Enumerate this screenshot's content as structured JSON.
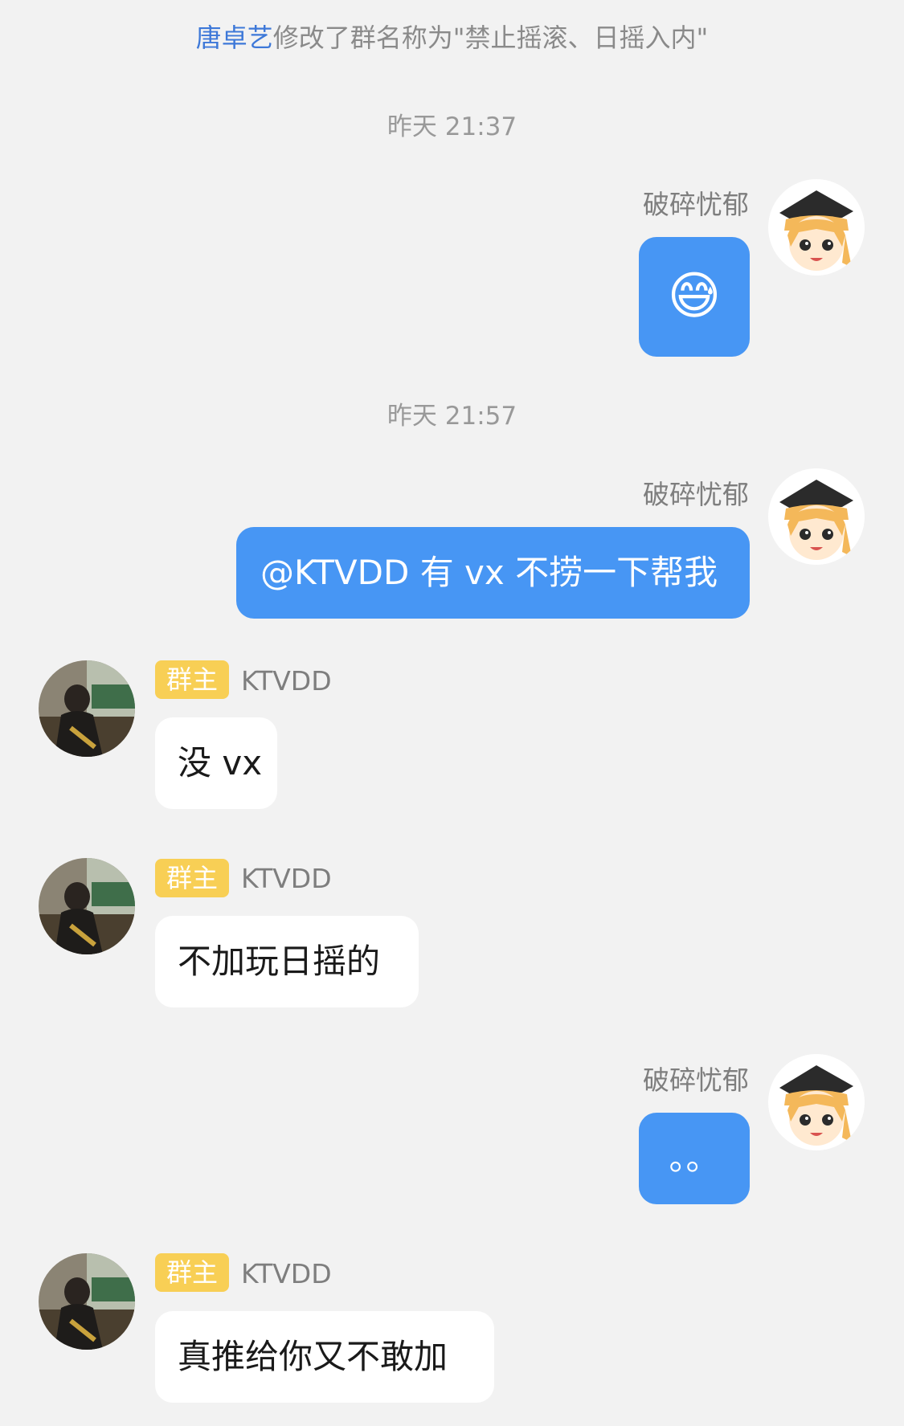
{
  "system_notice": {
    "actor": "唐卓艺",
    "text": "修改了群名称为\"禁止摇滚、日摇入内\""
  },
  "timestamps": [
    "昨天 21:37",
    "昨天 21:57"
  ],
  "badge_label": "群主",
  "messages": [
    {
      "sender": "破碎忧郁",
      "side": "right",
      "text": "😅"
    },
    {
      "sender": "破碎忧郁",
      "side": "right",
      "text": "@KTVDD 有 vx 不捞一下帮我"
    },
    {
      "sender": "KTVDD",
      "side": "left",
      "text": "没 vx"
    },
    {
      "sender": "KTVDD",
      "side": "left",
      "text": "不加玩日摇的"
    },
    {
      "sender": "破碎忧郁",
      "side": "right",
      "text": "。。"
    },
    {
      "sender": "KTVDD",
      "side": "left",
      "text": "真推给你又不敢加"
    }
  ],
  "colors": {
    "self_bubble": "#4796f4",
    "other_bubble": "#ffffff",
    "badge": "#f8cf55",
    "actor_link": "#3d78d8"
  }
}
